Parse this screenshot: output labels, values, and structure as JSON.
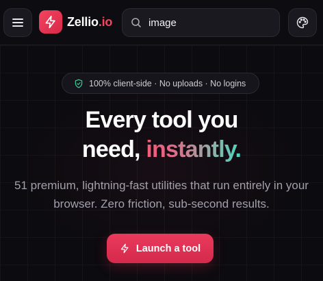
{
  "header": {
    "menu_icon": "hamburger-menu-icon",
    "logo_icon": "lightning-bolt-icon",
    "brand_name": "Zellio",
    "brand_tld": ".io",
    "search": {
      "icon": "search-icon",
      "value": "image",
      "placeholder": ""
    },
    "theme_icon": "palette-icon"
  },
  "hero": {
    "badge": {
      "icon": "shield-check-icon",
      "text": "100% client-side · No uploads · No logins"
    },
    "headline_line1": "Every tool you",
    "headline_line2_plain": "need, ",
    "headline_line2_accent": "instantly.",
    "subtitle": "51 premium, lightning-fast utilities that run entirely in your browser. Zero friction, sub-second results.",
    "cta": {
      "icon": "lightning-bolt-icon",
      "label": "Launch a tool"
    }
  },
  "colors": {
    "background": "#0c0b0f",
    "brand_red": "#e8385a",
    "brand_tld": "#f0475f",
    "accent_gradient_start": "#f25a78",
    "accent_gradient_end": "#4cd3bf",
    "badge_icon": "#34d399",
    "subtitle": "#a3a0ad"
  }
}
